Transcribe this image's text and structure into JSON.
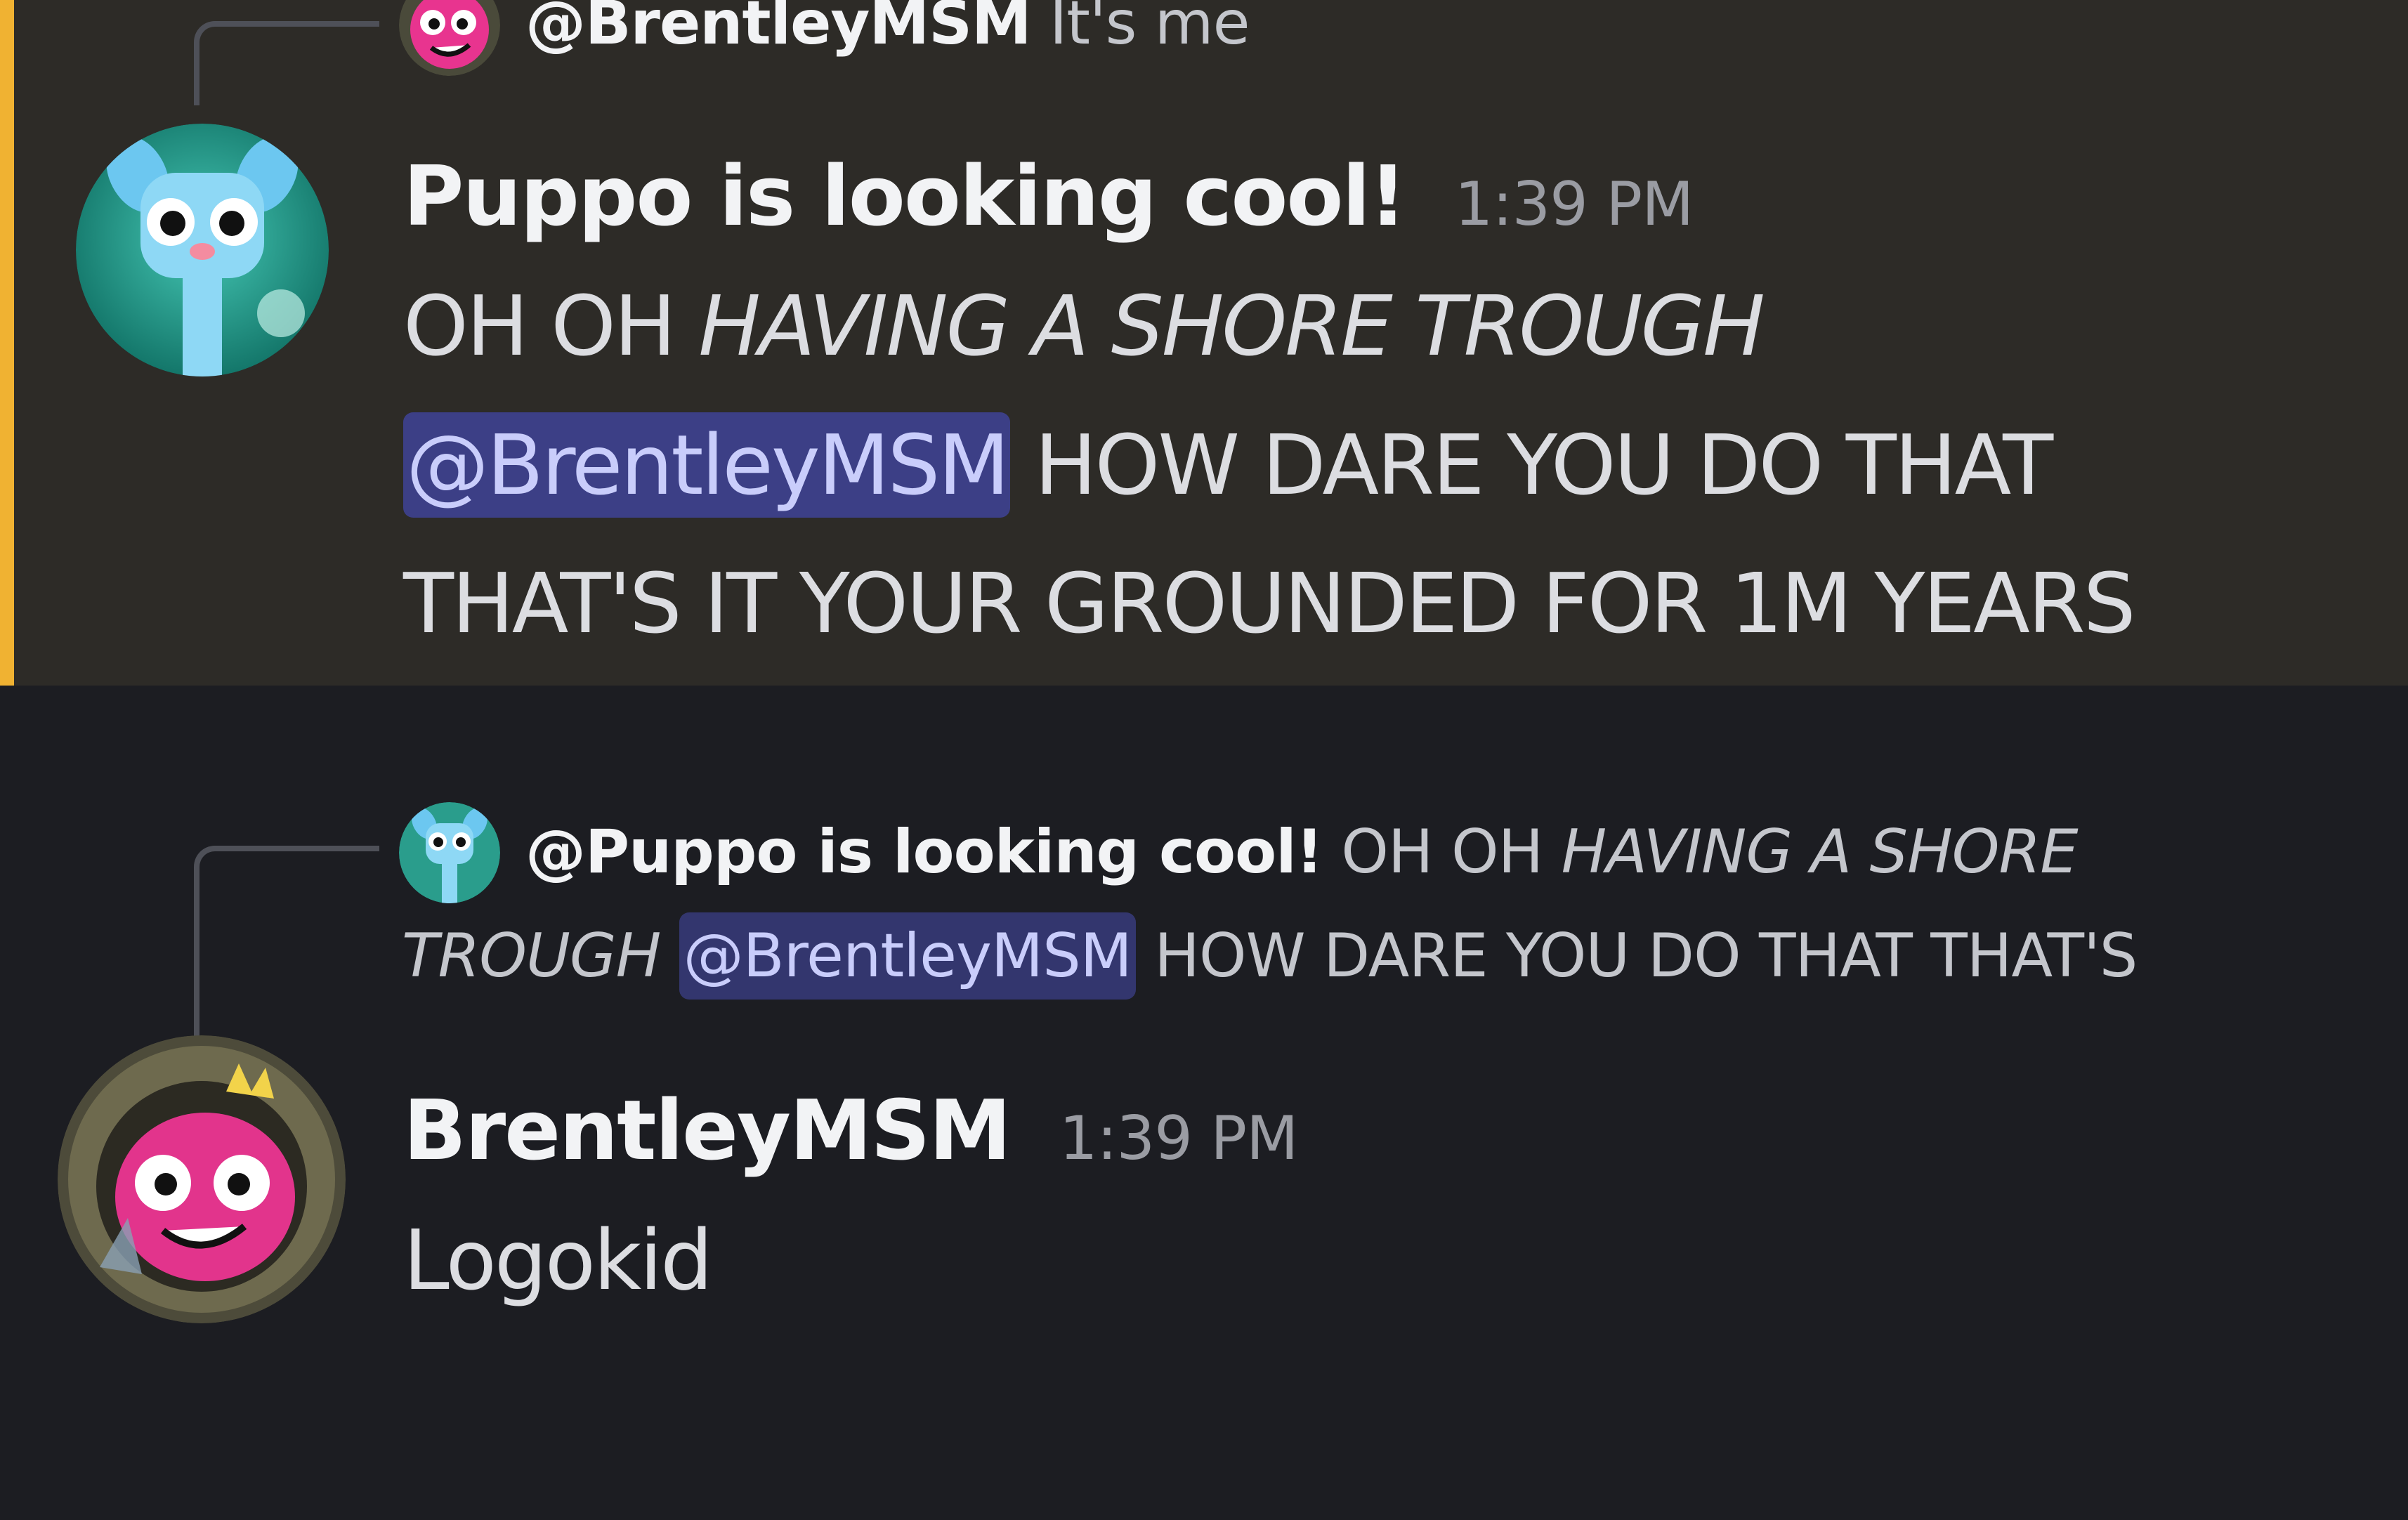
{
  "message_1": {
    "reply": {
      "username": "@BrentleyMSM",
      "text": "It's me"
    },
    "author": "Puppo is looking cool!",
    "timestamp": "1:39 PM",
    "lines": {
      "l1_plain": "OH OH ",
      "l1_italic": "HAVING A SHORE TROUGH",
      "l2_mention": "@BrentleyMSM",
      "l2_rest": " HOW DARE YOU DO THAT",
      "l3": "THAT'S IT YOUR GROUNDED FOR 1M YEARS"
    },
    "mentioned": true
  },
  "message_2": {
    "reply": {
      "username": "@Puppo is looking cool!",
      "l1_plain": " OH OH ",
      "l1_italic": "HAVING A SHORE",
      "l2_italic": "TROUGH",
      "l2_mention": "@BrentleyMSM",
      "l2_rest": " HOW DARE YOU DO THAT THAT'S"
    },
    "author": "BrentleyMSM",
    "timestamp": "1:39 PM",
    "content": "Logokid"
  },
  "colors": {
    "mention_highlight_bar": "#f0b232",
    "highlighted_bg": "#2d2b27",
    "normal_bg": "#1c1d22",
    "mention_pill": "#3c3f86"
  },
  "icons": {
    "puppo_avatar": "blue-dog-avatar",
    "brentley_avatar": "pink-monster-avatar"
  }
}
